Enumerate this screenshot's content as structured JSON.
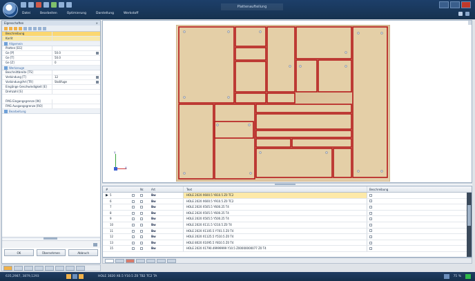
{
  "window": {
    "title": "Plattenaufteilung",
    "menu": [
      "Datei",
      "Bearbeiten",
      "Optimierung",
      "Darstellung",
      "Werkstoff"
    ],
    "left_panel_title": "Eigenschaften"
  },
  "properties": {
    "rows": [
      {
        "key": "Beschreibung",
        "value": ""
      },
      {
        "key": "Karlit",
        "value": ""
      },
      {
        "key": "Platten [EG]",
        "value": ""
      },
      {
        "key": "Ge [P]",
        "value": "50.0"
      },
      {
        "key": "Ge [T]",
        "value": "50.0"
      },
      {
        "key": "Ge [Z]",
        "value": "0"
      },
      {
        "key": "Beschnittbreite [TS]",
        "value": ""
      },
      {
        "key": "Verbindung [T]",
        "value": "12"
      },
      {
        "key": "Vorbindung/Art [TR]",
        "value": "Stoßfuge"
      },
      {
        "key": "Eingänge Geschwindigkeit [E]",
        "value": ""
      },
      {
        "key": "Drehzahl [S]",
        "value": ""
      },
      {
        "key": "FMG Eingangsgrenze [IN]",
        "value": ""
      },
      {
        "key": "FMG Ausgangsgrenze [RO]",
        "value": ""
      }
    ],
    "sections": [
      "Allgemein",
      "Werkzeuge",
      "Bearbeitung",
      "Optionen"
    ]
  },
  "buttons": {
    "ok": "OK",
    "apply": "Übernehmen",
    "cancel": "Abbruch"
  },
  "axes": {
    "y": "Y",
    "x": "X"
  },
  "grid": {
    "headers": {
      "id": "#",
      "num": "Nr.",
      "type": "Art",
      "text": "Text",
      "desc": "Beschreibung"
    },
    "rows": [
      {
        "id": "5",
        "type": "Bw",
        "text": "HOLE 2020 X600.5 Y810.5 Z0 TC2",
        "selected": true
      },
      {
        "id": "6",
        "type": "Bw",
        "text": "HOLE 2020 X600.5 Y910.5 Z0 TC2",
        "selected": false
      },
      {
        "id": "7",
        "type": "Bw",
        "text": "HOLE 2020 X505.5 Y600.25 T4",
        "selected": false
      },
      {
        "id": "8",
        "type": "Bw",
        "text": "HOLE 2020 X505.5 Y600.25 T4",
        "selected": false
      },
      {
        "id": "9",
        "type": "Bw",
        "text": "HOLE 2020 X505.5 Y500.25 T4",
        "selected": false
      },
      {
        "id": "10",
        "type": "Bw",
        "text": "HOLE 2020 X111.5 Y210.5 Z0 T4",
        "selected": false
      },
      {
        "id": "11",
        "type": "Bw",
        "text": "HOLE 2020 X1105.5 Y701.5 Z0 T4",
        "selected": false
      },
      {
        "id": "12",
        "type": "Bw",
        "text": "HOLE 2020 X1125.5 Y510.5 Z0 T4",
        "selected": false
      },
      {
        "id": "13",
        "type": "Bw",
        "text": "HOLE 8020 X1095.5 Y810.5 Z0 T4",
        "selected": false
      },
      {
        "id": "15",
        "type": "Bw",
        "text": "HOLE 2020 X1790.49999999 Y10.5 Z00000000077 Z0 T4",
        "selected": false
      }
    ]
  },
  "status": {
    "coords": "635,2987, 3879,1293",
    "message": "HOLE 3020 X6.5 Y10.5 Z0 TB2 TC2 TA",
    "zoom": "75 %"
  }
}
